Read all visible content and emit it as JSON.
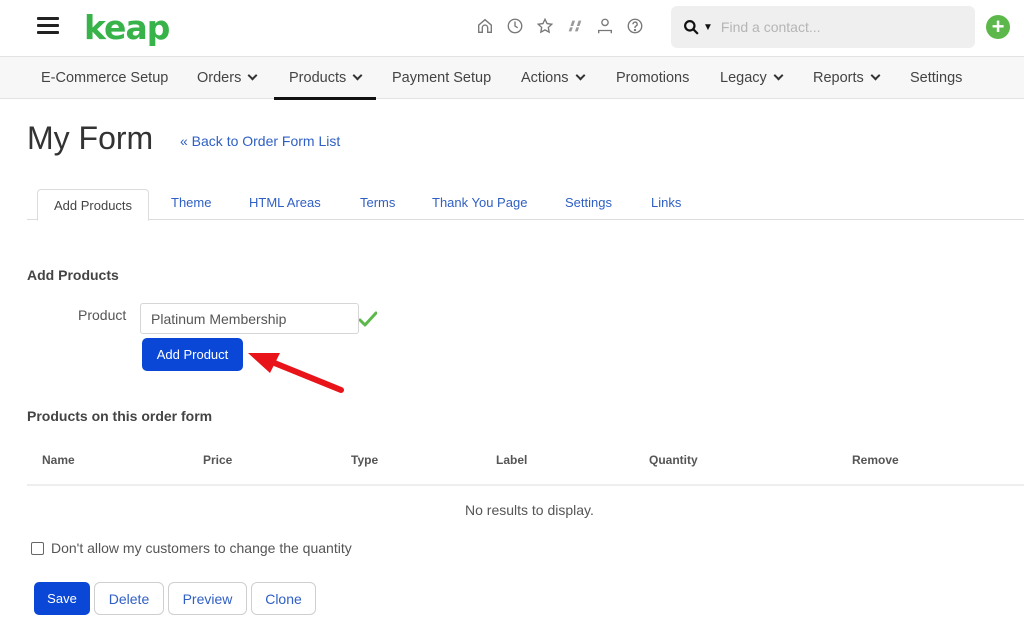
{
  "header": {
    "logo_text": "keap",
    "icons": [
      "home-icon",
      "clock-icon",
      "star-icon",
      "fast-forward-icon",
      "user-icon",
      "help-icon"
    ],
    "search": {
      "placeholder": "Find a contact..."
    },
    "add_label": "+"
  },
  "nav": {
    "items": [
      {
        "label": "E-Commerce Setup",
        "dropdown": false
      },
      {
        "label": "Orders",
        "dropdown": true
      },
      {
        "label": "Products",
        "dropdown": true,
        "active": true
      },
      {
        "label": "Payment Setup",
        "dropdown": false
      },
      {
        "label": "Actions",
        "dropdown": true
      },
      {
        "label": "Promotions",
        "dropdown": false
      },
      {
        "label": "Legacy",
        "dropdown": true
      },
      {
        "label": "Reports",
        "dropdown": true
      },
      {
        "label": "Settings",
        "dropdown": false
      }
    ]
  },
  "page": {
    "title": "My Form",
    "back_link": "« Back to Order Form List"
  },
  "tabs": [
    {
      "label": "Add Products",
      "active": true
    },
    {
      "label": "Theme"
    },
    {
      "label": "HTML Areas"
    },
    {
      "label": "Terms"
    },
    {
      "label": "Thank You Page"
    },
    {
      "label": "Settings"
    },
    {
      "label": "Links"
    }
  ],
  "add_products": {
    "section_title": "Add Products",
    "product_label": "Product",
    "product_value": "Platinum Membership",
    "add_button": "Add Product"
  },
  "products_table": {
    "section_title": "Products on this order form",
    "columns": [
      "Name",
      "Price",
      "Type",
      "Label",
      "Quantity",
      "Remove"
    ],
    "rows": [],
    "empty_message": "No results to display."
  },
  "options": {
    "lock_quantity_label": "Don't allow my customers to change the quantity",
    "lock_quantity_checked": false
  },
  "actions": {
    "save": "Save",
    "delete": "Delete",
    "preview": "Preview",
    "clone": "Clone"
  },
  "colors": {
    "brand_green": "#37b34a",
    "primary_blue": "#0a47d6",
    "link_blue": "#2f5fc4",
    "annotation_red": "#e8141a"
  }
}
